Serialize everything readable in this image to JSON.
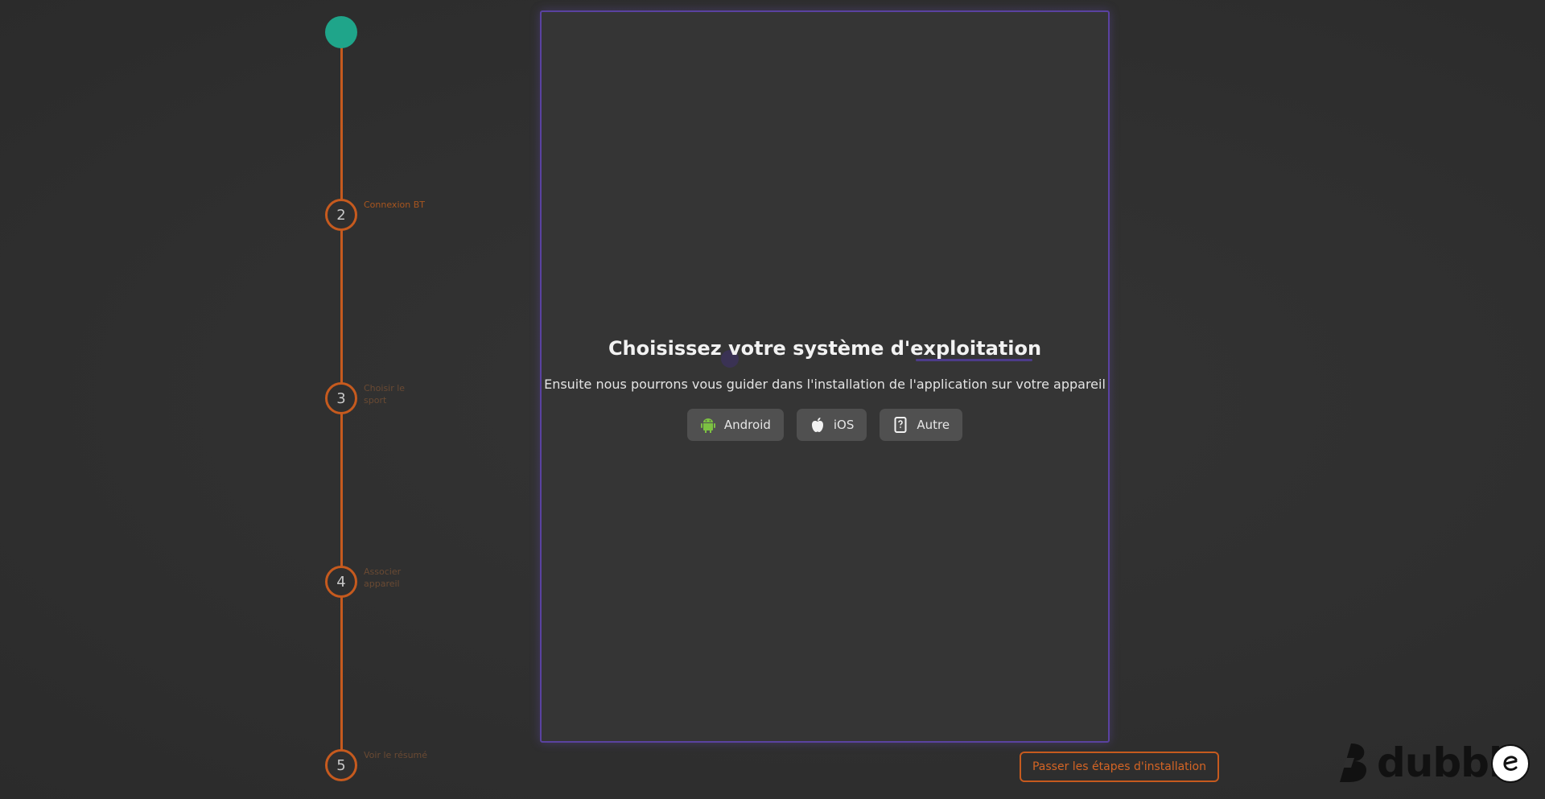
{
  "stepper": {
    "steps": [
      {
        "number": "",
        "label": "",
        "state": "done"
      },
      {
        "number": "2",
        "label": "Connexion BT",
        "state": "active"
      },
      {
        "number": "3",
        "label": "Choisir le sport",
        "state": "pending"
      },
      {
        "number": "4",
        "label": "Associer appareil",
        "state": "pending"
      },
      {
        "number": "5",
        "label": "Voir le résumé",
        "state": "pending"
      }
    ]
  },
  "panel": {
    "title": "Choisissez votre système d'exploitation",
    "subtitle": "Ensuite nous pourrons vous guider dans l'installation de l'application sur votre appareil",
    "os_options": [
      {
        "label": "Android",
        "icon": "android-icon"
      },
      {
        "label": "iOS",
        "icon": "apple-icon"
      },
      {
        "label": "Autre",
        "icon": "unknown-phone-icon"
      }
    ]
  },
  "skip_button_label": "Passer les étapes d'installation",
  "brand": {
    "name": "dubble",
    "colors": {
      "accent": "#c65a1e",
      "done": "#1fa58a",
      "panel_border": "#5a42a0",
      "android": "#7cc142"
    }
  }
}
